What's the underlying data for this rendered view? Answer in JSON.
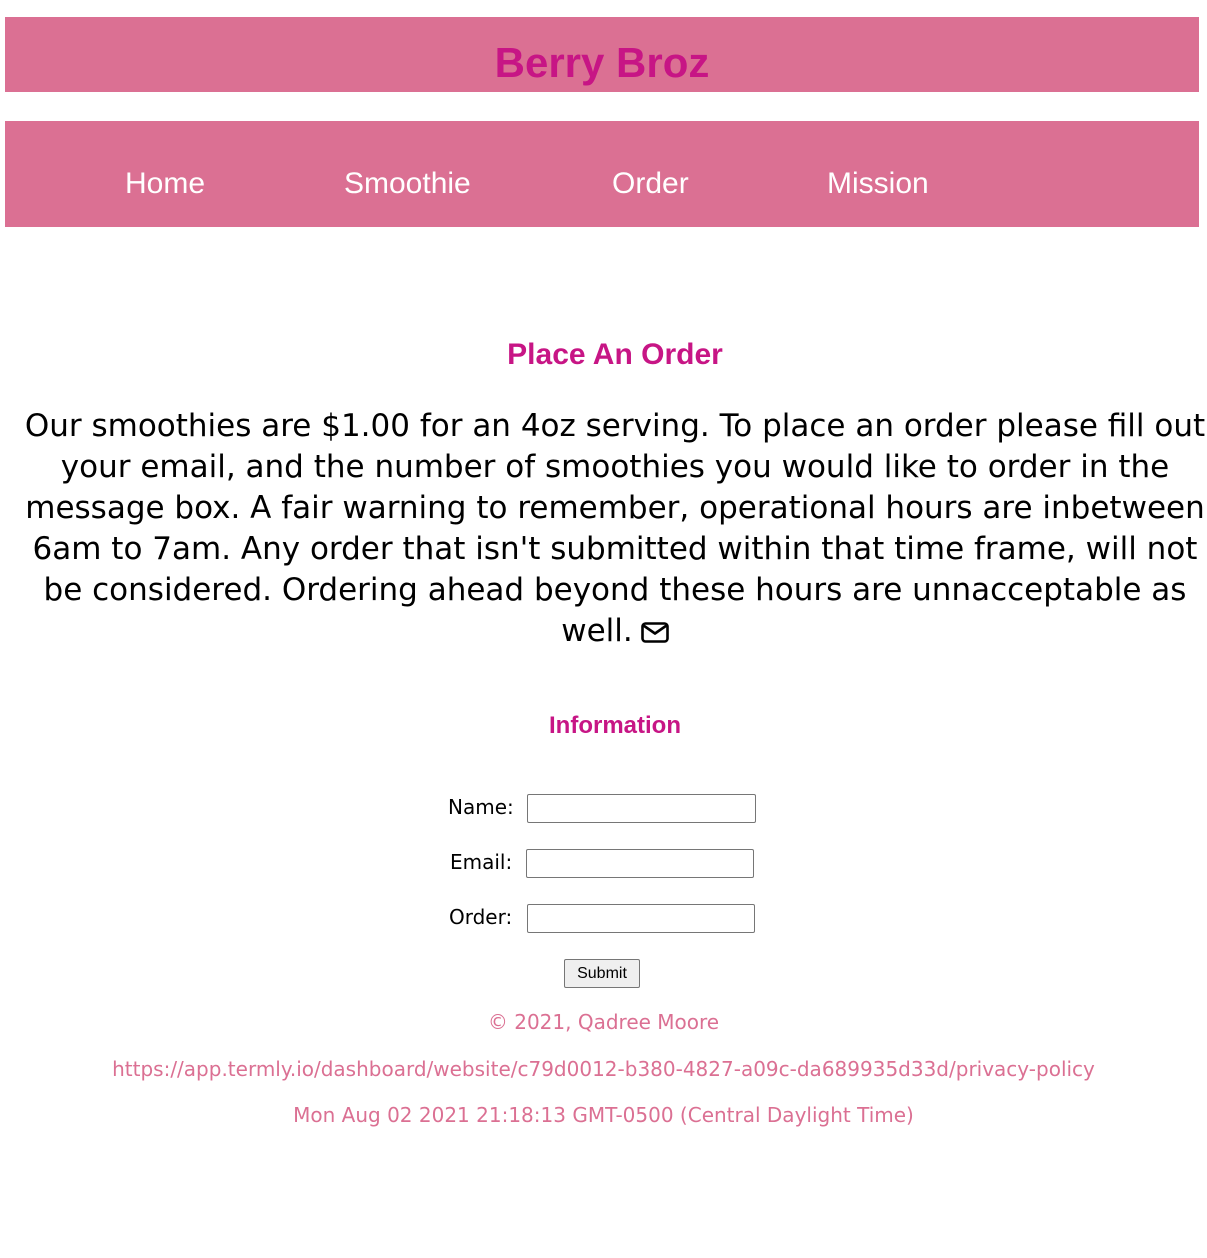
{
  "header": {
    "title": "Berry Broz"
  },
  "nav": {
    "items": [
      {
        "label": "Home"
      },
      {
        "label": "Smoothie"
      },
      {
        "label": "Order"
      },
      {
        "label": "Mission"
      }
    ]
  },
  "main": {
    "heading": "Place An Order",
    "intro": "Our smoothies are $1.00 for an 4oz serving. To place an order please fill out your email, and the number of smoothies you would like to order in the message box. A fair warning to remember, operational hours are inbetween 6am to 7am. Any order that isn't submitted within that time frame, will not be considered. Ordering ahead beyond these hours are unnacceptable as well.",
    "intro_icon": "envelope-icon"
  },
  "form": {
    "heading": "Information",
    "name_label": "Name:",
    "name_value": "",
    "email_label": "Email:",
    "email_value": "",
    "order_label": "Order:",
    "order_value": "",
    "submit_label": "Submit"
  },
  "footer": {
    "copyright": "© 2021, Qadree Moore",
    "privacy_url": "https://app.termly.io/dashboard/website/c79d0012-b380-4827-a09c-da689935d33d/privacy-policy",
    "timestamp": "Mon Aug 02 2021 21:18:13 GMT-0500 (Central Daylight Time)"
  },
  "colors": {
    "bar": "#db7093",
    "accent": "#c71585",
    "nav_text": "#ffffff",
    "footer_text": "#db7093"
  }
}
